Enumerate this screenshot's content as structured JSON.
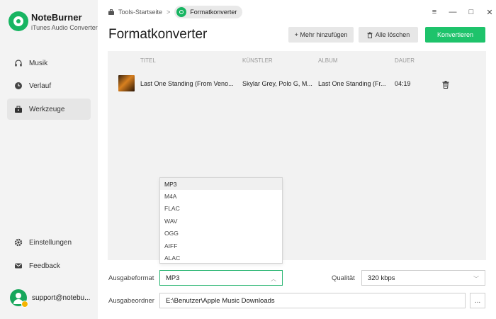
{
  "app": {
    "brand": "NoteBurner",
    "subtitle": "iTunes Audio Converter"
  },
  "sidebar": {
    "items": [
      {
        "label": "Musik",
        "icon": "headphones-icon"
      },
      {
        "label": "Verlauf",
        "icon": "clock-icon"
      },
      {
        "label": "Werkzeuge",
        "icon": "toolbox-icon",
        "active": true
      }
    ],
    "bottom": [
      {
        "label": "Einstellungen",
        "icon": "gear-icon"
      },
      {
        "label": "Feedback",
        "icon": "mail-icon"
      }
    ],
    "user": "support@notebu..."
  },
  "breadcrumb": {
    "home": "Tools-Startseite",
    "separator": ">",
    "current": "Formatkonverter"
  },
  "window_controls": {
    "menu": "≡",
    "minimize": "—",
    "maximize": "□",
    "close": "✕"
  },
  "page": {
    "title": "Formatkonverter",
    "add_button": "+ Mehr hinzufügen",
    "clear_button": "Alle löschen",
    "convert_button": "Konvertieren"
  },
  "table": {
    "headers": {
      "title": "TITEL",
      "artist": "KÜNSTLER",
      "album": "ALBUM",
      "duration": "DAUER"
    },
    "rows": [
      {
        "title": "Last One Standing (From Veno...",
        "artist": "Skylar Grey, Polo G, M...",
        "album": "Last One Standing (Fr...",
        "duration": "04:19"
      }
    ]
  },
  "format_dropdown": {
    "options": [
      "MP3",
      "M4A",
      "FLAC",
      "WAV",
      "OGG",
      "AIFF",
      "ALAC"
    ],
    "selected": "MP3"
  },
  "settings": {
    "format_label": "Ausgabeformat",
    "format_value": "MP3",
    "quality_label": "Qualität",
    "quality_value": "320 kbps",
    "folder_label": "Ausgabeordner",
    "folder_value": "E:\\Benutzer\\Apple Music Downloads",
    "browse_label": "..."
  },
  "colors": {
    "accent": "#1ec36b",
    "brand": "#18b562"
  }
}
